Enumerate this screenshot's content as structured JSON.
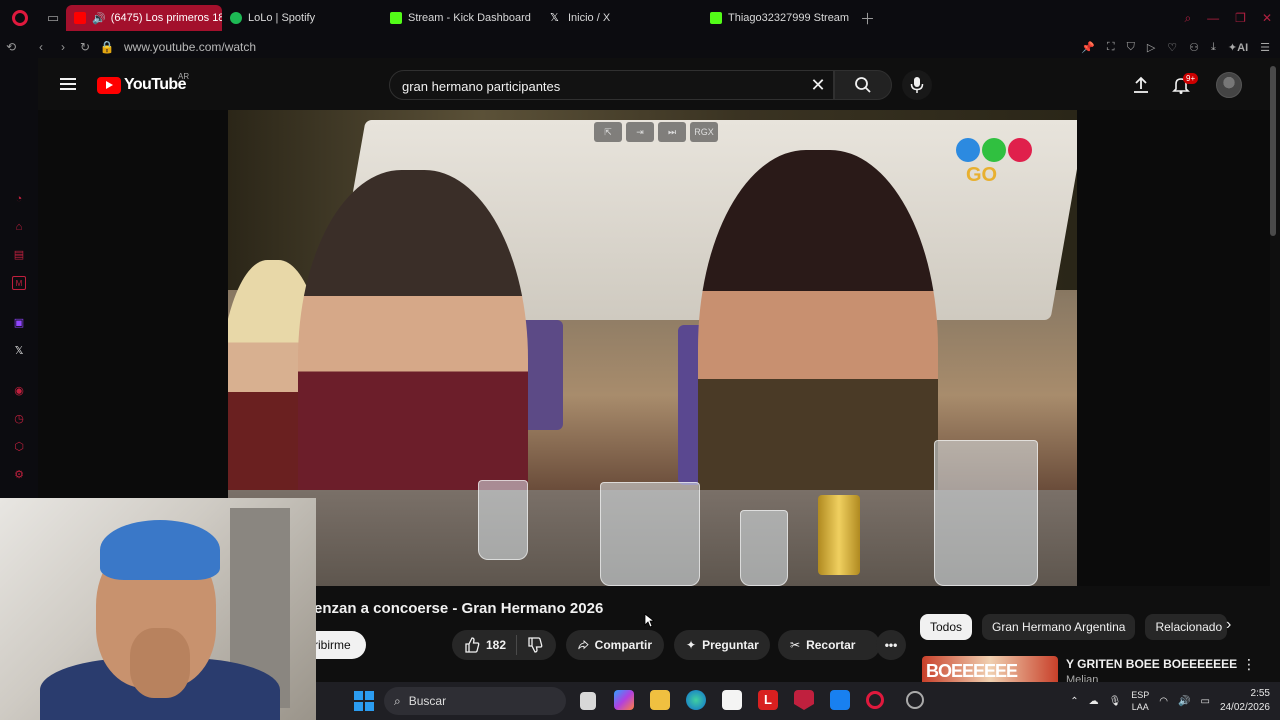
{
  "browser": {
    "tabs": [
      {
        "label": "(6475) Los primeros 18",
        "favicon_color": "#ff0000",
        "active": true
      },
      {
        "label": "LoLo | Spotify",
        "favicon_color": "#1db954",
        "active": false
      },
      {
        "label": "Stream - Kick Dashboard",
        "favicon_color": "#53fc18",
        "active": false
      },
      {
        "label": "Inicio / X",
        "favicon_color": "#ffffff",
        "active": false
      },
      {
        "label": "Thiago32327999 Stream -",
        "favicon_color": "#53fc18",
        "active": false
      }
    ],
    "url": "www.youtube.com/watch",
    "ai_label": "AI"
  },
  "youtube": {
    "logo_text": "YouTube",
    "country": "AR",
    "search_query": "gran hermano participantes",
    "notification_count": "9+",
    "video_logo_text": "GO",
    "video_overlay_badge": "RGX"
  },
  "video_meta": {
    "title": "enzan a concoerse - Gran Hermano 2026",
    "subscribe_label": "ribirme",
    "like_count": "182",
    "share_label": "Compartir",
    "ask_label": "Preguntar",
    "clip_label": "Recortar"
  },
  "sidebar_chips": [
    "Todos",
    "Gran Hermano Argentina",
    "Relacionado"
  ],
  "recommendation": {
    "thumb_text": "BOEEEEEE",
    "title": "Y GRITEN BOEE BOEEEEEEE",
    "channel": "Melian"
  },
  "taskbar": {
    "search_label": "Buscar",
    "lang_line1": "ESP",
    "lang_line2": "LAA",
    "time": "2:55",
    "date": "24/02/2026"
  },
  "colors": {
    "opera_accent": "#e0193d",
    "youtube_red": "#ff0000",
    "active_tab": "#a3102c"
  }
}
